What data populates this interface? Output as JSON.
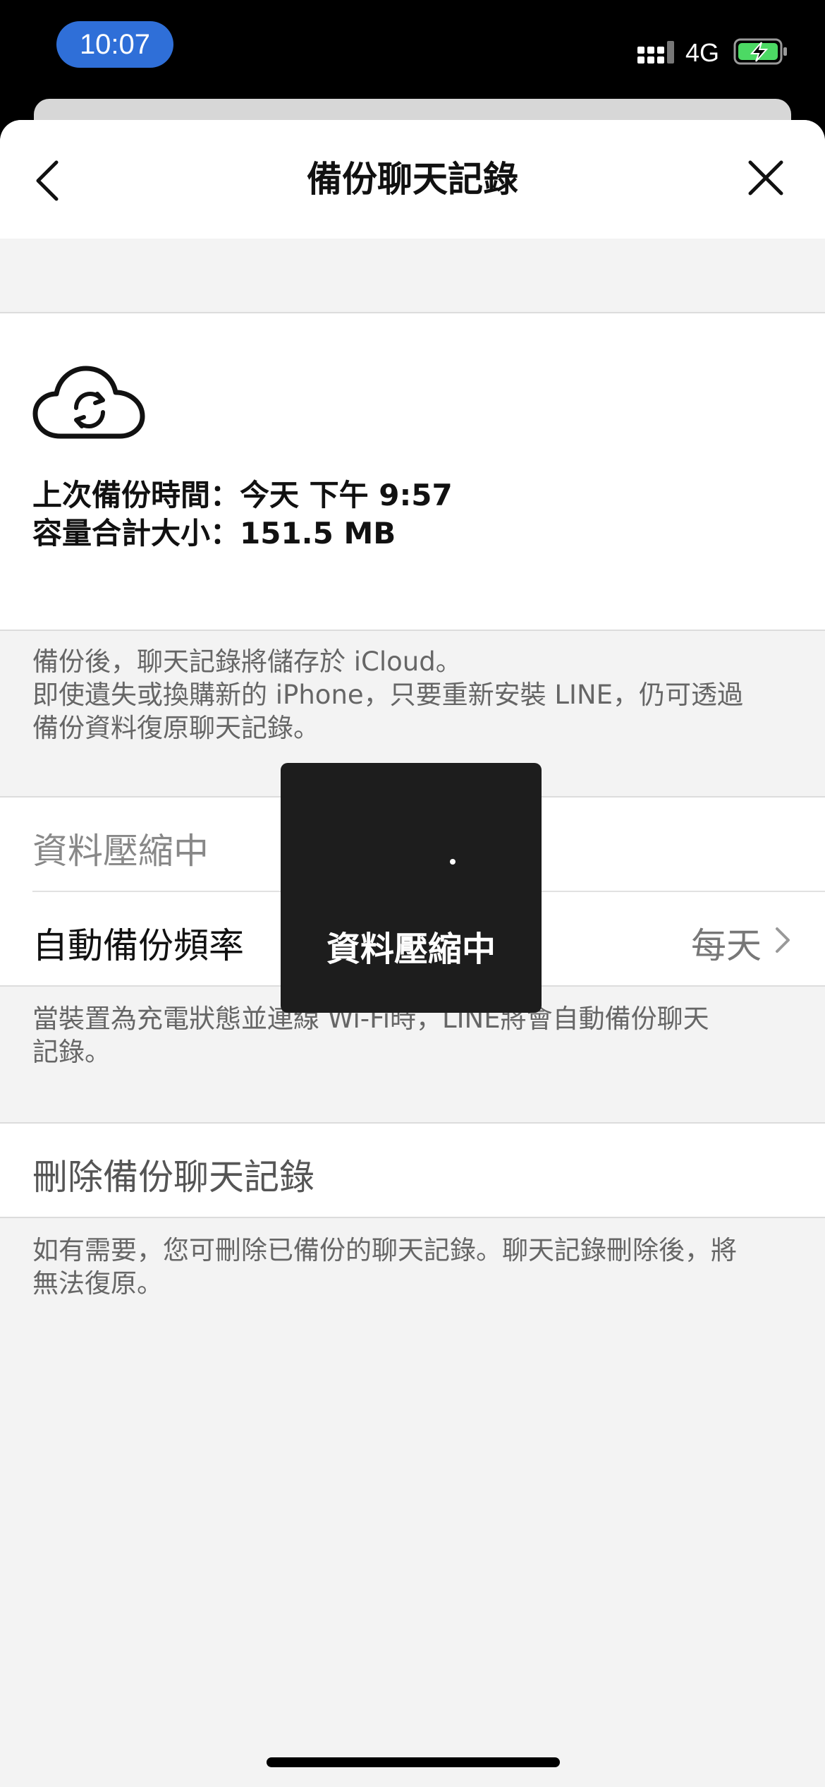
{
  "status_bar": {
    "time": "10:07",
    "network": "4G",
    "icons": [
      "signal-icon",
      "battery-charging-icon"
    ]
  },
  "nav": {
    "title": "備份聊天記錄",
    "icons": [
      "back-icon",
      "close-icon"
    ]
  },
  "backup_info": {
    "icon": "cloud-sync-icon",
    "last_backup": "上次備份時間：今天 下午 9:57",
    "total_size": "容量合計大小：151.5 MB"
  },
  "backup_note": {
    "line1": "備份後，聊天記錄將儲存於 iCloud。",
    "line2": "即使遺失或換購新的 iPhone，只要重新安裝 LINE，仍可透過",
    "line3": "備份資料復原聊天記錄。"
  },
  "compress_row": {
    "label": "資料壓縮中"
  },
  "auto_backup_row": {
    "label": "自動備份頻率",
    "value": "每天"
  },
  "auto_note": {
    "line1": "當裝置為充電狀態並連線 Wi-Fi時，LINE將會自動備份聊天",
    "line2": "記錄。"
  },
  "delete_row": {
    "label": "刪除備份聊天記錄"
  },
  "delete_note": {
    "line1": "如有需要，您可刪除已備份的聊天記錄。聊天記錄刪除後，將",
    "line2": "無法復原。"
  },
  "overlay": {
    "text": "資料壓縮中"
  },
  "colors": {
    "time_pill": "#2f6fd8",
    "battery": "#4cd964",
    "overlay_bg": "#1d1d1d",
    "page_bg": "#f3f3f3"
  }
}
